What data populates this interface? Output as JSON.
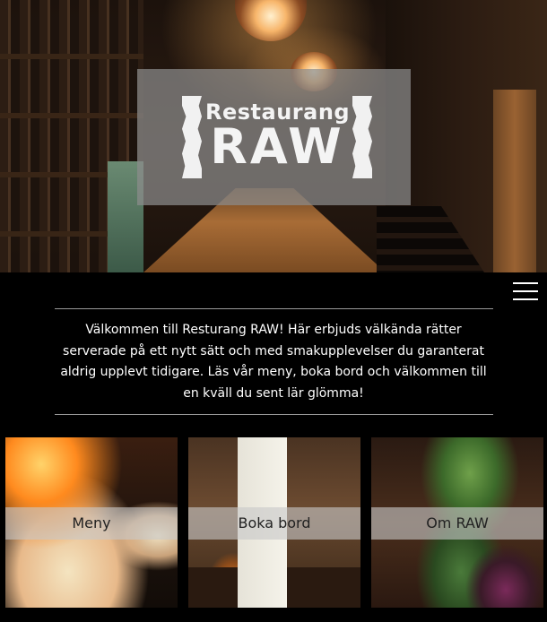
{
  "hero": {
    "logo_top": "Restaurang",
    "logo_main": "RAW"
  },
  "nav": {
    "menu_icon": "hamburger-menu-icon"
  },
  "welcome": {
    "text": "Välkommen till Resturang RAW! Här erbjuds välkända rätter serverade på ett nytt sätt och med smakupplevelser du garanterat aldrig upplevt tidigare. Läs vår meny, boka bord och välkommen till en kväll du sent lär glömma!"
  },
  "cards": [
    {
      "label": "Meny"
    },
    {
      "label": "Boka bord"
    },
    {
      "label": "Om RAW"
    }
  ]
}
